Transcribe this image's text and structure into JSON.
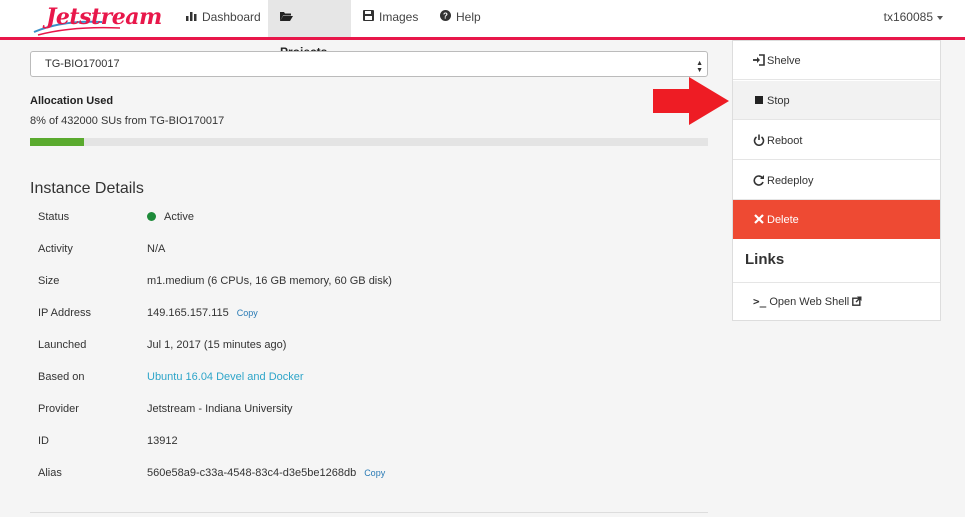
{
  "navbar": {
    "logo_text": "Jetstream",
    "items": [
      {
        "label": "Dashboard",
        "icon": "bar-chart-icon"
      },
      {
        "label": "Projects",
        "icon": "folder-open-icon",
        "active": true
      },
      {
        "label": "Images",
        "icon": "floppy-disk-icon"
      },
      {
        "label": "Help",
        "icon": "question-circle-icon"
      }
    ],
    "user": "tx160085"
  },
  "allocation": {
    "selected": "TG-BIO170017",
    "title": "Allocation Used",
    "summary": "8% of 432000 SUs from TG-BIO170017",
    "percent": 8
  },
  "details": {
    "title": "Instance Details",
    "rows": [
      {
        "label": "Status",
        "value": "Active"
      },
      {
        "label": "Activity",
        "value": "N/A"
      },
      {
        "label": "Size",
        "value": "m1.medium (6 CPUs, 16 GB memory, 60 GB disk)"
      },
      {
        "label": "IP Address",
        "value": "149.165.157.115",
        "copy": "Copy"
      },
      {
        "label": "Launched",
        "value": "Jul 1, 2017 (15 minutes ago)"
      },
      {
        "label": "Based on",
        "value": "Ubuntu 16.04 Devel and Docker"
      },
      {
        "label": "Provider",
        "value": "Jetstream - Indiana University"
      },
      {
        "label": "ID",
        "value": "13912"
      },
      {
        "label": "Alias",
        "value": "560e58a9-c33a-4548-83c4-d3e5be1268db",
        "copy": "Copy"
      }
    ]
  },
  "actions": {
    "items": [
      {
        "label": "Shelve",
        "icon": "sign-in-icon"
      },
      {
        "label": "Stop",
        "icon": "stop-icon"
      },
      {
        "label": "Reboot",
        "icon": "power-icon"
      },
      {
        "label": "Redeploy",
        "icon": "redo-icon"
      },
      {
        "label": "Delete",
        "icon": "times-icon"
      }
    ],
    "links_title": "Links",
    "web_shell": "Open Web Shell"
  },
  "colors": {
    "accent": "#e8174a",
    "delete": "#ee4a33",
    "status_active": "#1e8b3a",
    "progress": "#5aaa2e",
    "arrow": "#ee1c24"
  }
}
